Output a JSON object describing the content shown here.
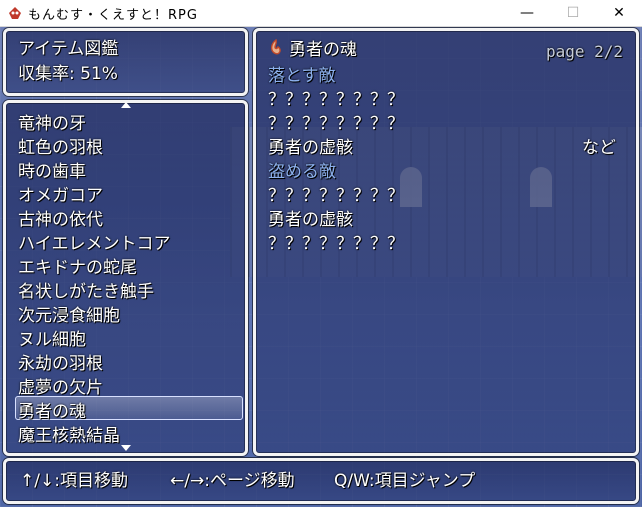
{
  "window": {
    "title": "もんむす・くえすと！RPG",
    "minimize_glyph": "—",
    "maximize_glyph": "☐",
    "close_glyph": "✕",
    "icon": "game-app-icon"
  },
  "header": {
    "title": "アイテム図鑑",
    "collection_rate": "収集率: 51%"
  },
  "item_list": {
    "items": [
      "竜神の牙",
      "虹色の羽根",
      "時の歯車",
      "オメガコア",
      "古神の依代",
      "ハイエレメントコア",
      "エキドナの蛇尾",
      "名状しがたき触手",
      "次元浸食細胞",
      "ヌル細胞",
      "永劫の羽根",
      "虚夢の欠片",
      "勇者の魂",
      "魔王核熱結晶"
    ],
    "selected_index": 12
  },
  "detail": {
    "item_name": "勇者の魂",
    "item_icon": "flame-soul-icon",
    "page": "page 2/2",
    "drop_label": "落とす敵",
    "drop_enemies": [
      "？？？？？？？？",
      "？？？？？？？？",
      "勇者の虚骸"
    ],
    "etc_label": "など",
    "steal_label": "盗める敵",
    "steal_enemies": [
      "？？？？？？？？",
      "勇者の虚骸",
      "？？？？？？？？"
    ]
  },
  "help": {
    "item_move": "↑/↓:項目移動",
    "page_move": "←/→:ページ移動",
    "item_jump": "Q/W:項目ジャンプ"
  },
  "colors": {
    "system_text": "#8cb0ec",
    "normal_text": "#ffffff",
    "window_border": "#f4f4f4",
    "window_fill": "#1e285c"
  }
}
